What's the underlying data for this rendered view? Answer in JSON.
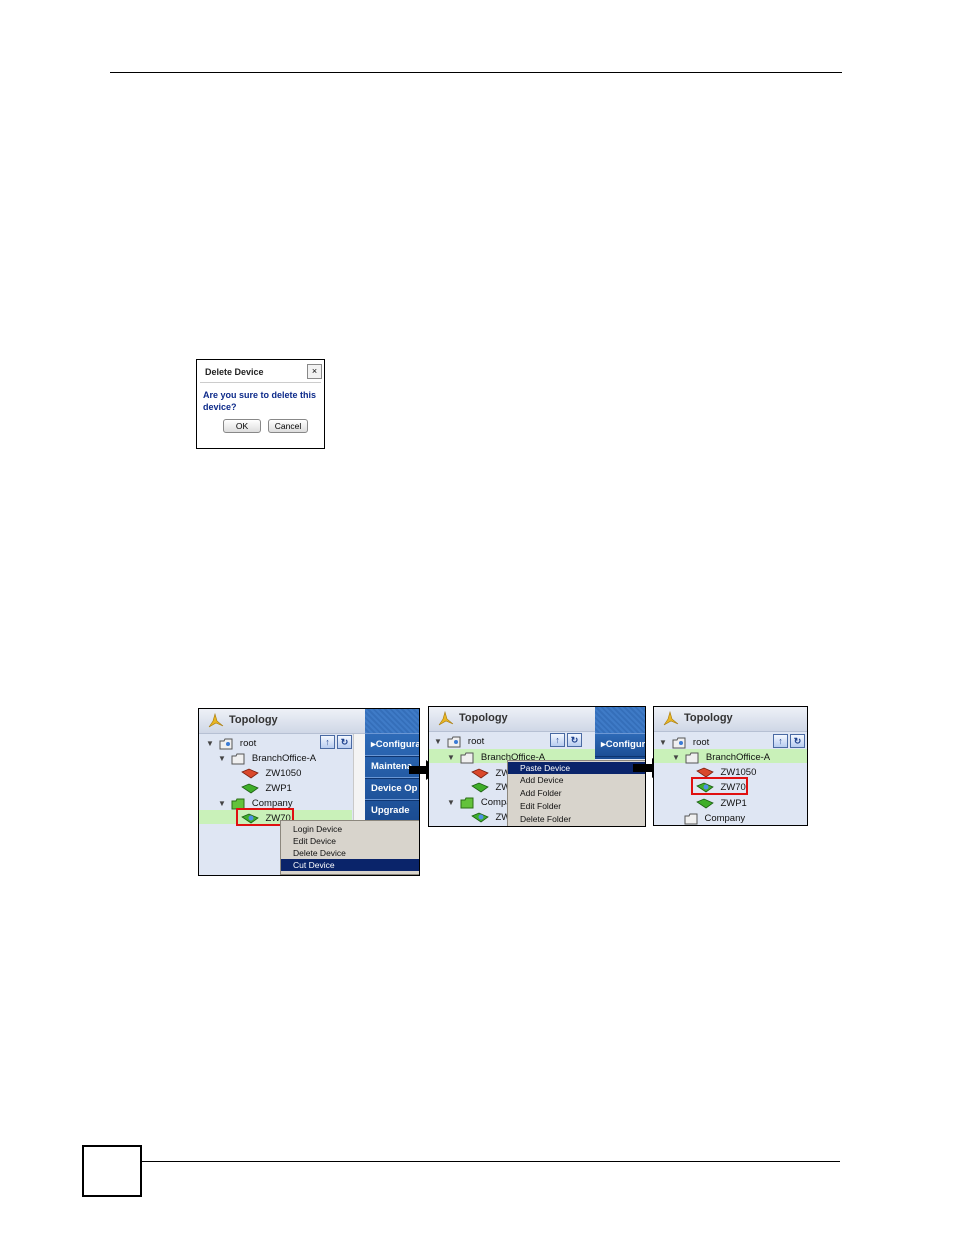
{
  "dialog": {
    "title": "Delete Device",
    "close_glyph": "×",
    "message": "Are you sure to delete this device?",
    "ok_label": "OK",
    "cancel_label": "Cancel"
  },
  "panel1": {
    "title": "Topology",
    "tree": {
      "root": "root",
      "branch": "BranchOffice-A",
      "device1": "ZW1050",
      "device2": "ZWP1",
      "folder": "Company",
      "device3": "ZW70"
    },
    "sidebar": [
      "Configura",
      "Maintena",
      "Device Op",
      "Upgrade"
    ],
    "menu": [
      "Login Device",
      "Edit Device",
      "Delete Device",
      "Cut Device"
    ]
  },
  "panel2": {
    "title": "Topology",
    "tree": {
      "root": "root",
      "branch": "BranchOffice-A",
      "device1": "ZW",
      "device2": "ZW",
      "folder": "Compa",
      "device3": "ZW"
    },
    "sidebar": [
      "Configur"
    ],
    "menu": [
      "Paste Device",
      "Add Device",
      "Add Folder",
      "Edit Folder",
      "Delete Folder"
    ]
  },
  "panel3": {
    "title": "Topology",
    "tree": {
      "root": "root",
      "branch": "BranchOffice-A",
      "device1": "ZW1050",
      "device2": "ZW70",
      "device3": "ZWP1",
      "folder": "Company"
    }
  },
  "toolbar": {
    "up_glyph": "↑",
    "refresh_glyph": "↻"
  },
  "colors": {
    "highlight": "#c9f1b9",
    "menu_selected": "#0a246a",
    "red_box": "#e01010",
    "sidebar": "#1a4b91"
  }
}
